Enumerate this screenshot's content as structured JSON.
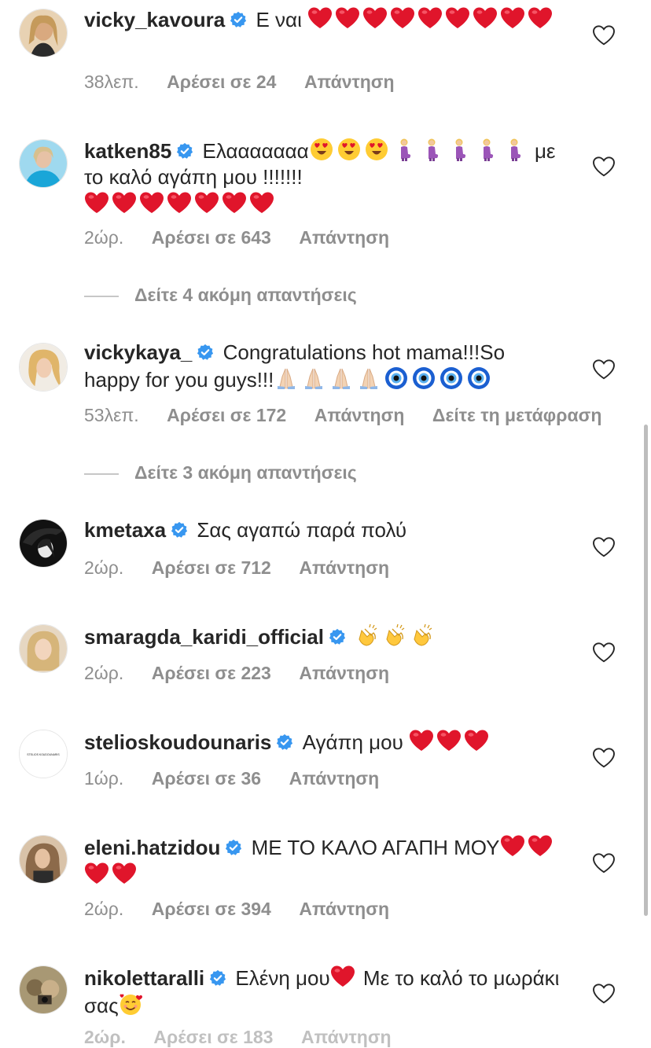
{
  "labels": {
    "likes_prefix": "Αρέσει σε",
    "reply": "Απάντηση",
    "translate": "Δείτε τη μετάφραση"
  },
  "comments": [
    {
      "username": "vicky_kavoura",
      "verified": true,
      "text": "Ε ναι",
      "trail": [
        "heart",
        "heart",
        "heart",
        "heart",
        "heart",
        "heart",
        "heart",
        "heart",
        "heart"
      ],
      "time": "38λεπ.",
      "likes": "24"
    },
    {
      "username": "katken85",
      "verified": true,
      "text": "Ελααααααα",
      "trail_a": [
        "heart-eyes",
        "heart-eyes",
        "heart-eyes",
        "pregnant",
        "pregnant",
        "pregnant",
        "pregnant",
        "pregnant"
      ],
      "text2": "με το καλό αγάπη μου !!!!!!!",
      "trail_b": [
        "heart",
        "heart",
        "heart",
        "heart",
        "heart",
        "heart",
        "heart"
      ],
      "time": "2ώρ.",
      "likes": "643"
    },
    {
      "username": "vickykaya_",
      "verified": true,
      "text": "Congratulations hot mama!!!So happy for you guys!!!",
      "trail": [
        "pray",
        "pray",
        "pray",
        "pray",
        "evil-eye",
        "evil-eye",
        "evil-eye",
        "evil-eye"
      ],
      "time": "53λεπ.",
      "likes": "172"
    },
    {
      "username": "kmetaxa",
      "verified": true,
      "text": "Σας αγαπώ παρά πολύ",
      "time": "2ώρ.",
      "likes": "712"
    },
    {
      "username": "smaragda_karidi_official",
      "verified": true,
      "text": "",
      "trail": [
        "clap",
        "clap",
        "clap"
      ],
      "time": "2ώρ.",
      "likes": "223"
    },
    {
      "username": "stelioskoudounaris",
      "verified": true,
      "text": "Αγάπη μου",
      "trail": [
        "heart",
        "heart",
        "heart"
      ],
      "time": "1ώρ.",
      "likes": "36",
      "avatar_text": "STELIOS KOUDOUNARIS"
    },
    {
      "username": "eleni.hatzidou",
      "verified": true,
      "text": "ΜΕ ΤΟ ΚΑΛΟ ΑΓΑΠΗ ΜΟΥ",
      "trail": [
        "heart",
        "heart",
        "heart",
        "heart"
      ],
      "time": "2ώρ.",
      "likes": "394"
    },
    {
      "username": "nikolettaralli",
      "verified": true,
      "text": "Ελένη μου",
      "mid_emoji": "heart",
      "text2": "Με το καλό το μωράκι σας",
      "end_emoji": "smiling-hearts",
      "time": "2ώρ.",
      "likes": "183"
    }
  ],
  "more_replies": [
    {
      "text": "Δείτε 4 ακόμη απαντήσεις"
    },
    {
      "text": "Δείτε 3 ακόμη απαντήσεις"
    }
  ],
  "colors": {
    "heart": "#e0152b",
    "verified": "#3897f0",
    "meta": "#8e8e8e",
    "text": "#262626"
  }
}
